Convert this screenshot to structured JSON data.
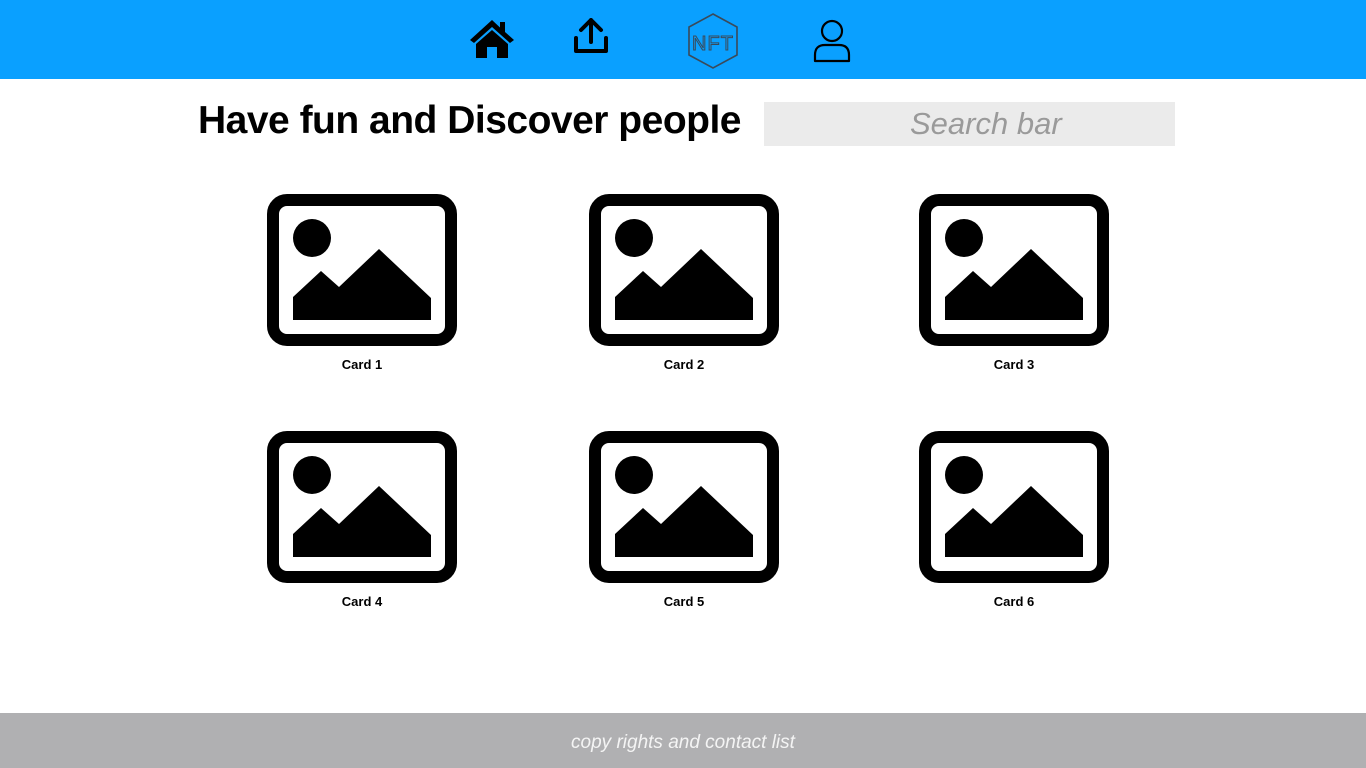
{
  "header": {
    "nav": [
      {
        "icon": "home-icon"
      },
      {
        "icon": "upload-icon"
      },
      {
        "icon": "nft-logo-icon",
        "label": "NFT"
      },
      {
        "icon": "user-icon"
      }
    ]
  },
  "main": {
    "title": "Have fun and Discover people",
    "search": {
      "placeholder": "Search bar",
      "value": ""
    },
    "cards": [
      {
        "label": "Card 1",
        "icon": "image-placeholder-icon"
      },
      {
        "label": "Card 2",
        "icon": "image-placeholder-icon"
      },
      {
        "label": "Card 3",
        "icon": "image-placeholder-icon"
      },
      {
        "label": "Card 4",
        "icon": "image-placeholder-icon"
      },
      {
        "label": "Card 5",
        "icon": "image-placeholder-icon"
      },
      {
        "label": "Card 6",
        "icon": "image-placeholder-icon"
      }
    ]
  },
  "footer": {
    "text": "copy rights and contact list"
  },
  "colors": {
    "header_bg": "#0aa0ff",
    "footer_bg": "#b0b0b2",
    "search_bg": "#ebebeb",
    "nft_logo": "#3a4a5a"
  }
}
